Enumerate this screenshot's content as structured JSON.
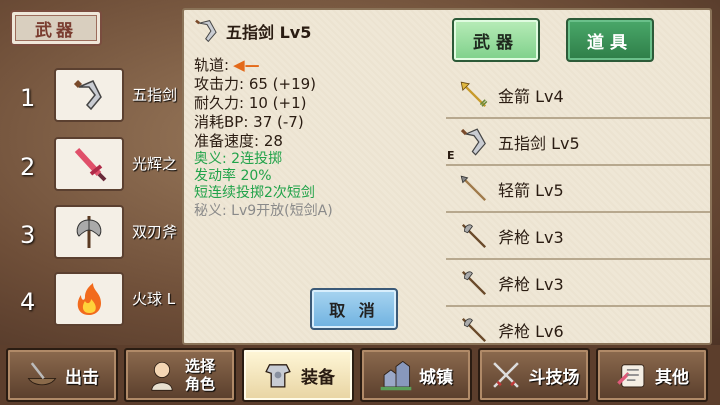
{
  "background_tag": "武器",
  "slots": [
    {
      "num": "1",
      "name": "五指剑",
      "icon": "five-finger-sword-icon"
    },
    {
      "num": "2",
      "name": "光辉之",
      "icon": "radiant-sword-icon"
    },
    {
      "num": "3",
      "name": "双刃斧",
      "icon": "double-axe-icon"
    },
    {
      "num": "4",
      "name": "火球 L",
      "icon": "fireball-icon"
    }
  ],
  "detail": {
    "title": "五指剑 Lv5",
    "track_label": "轨道:",
    "attack": "攻击力: 65 (+19)",
    "durability": "耐久力: 10 (+1)",
    "bp_cost": "消耗BP: 37 (-7)",
    "ready_speed": "准备速度: 28",
    "skill1": "奥义:  2连投掷",
    "skill2": "发动率 20%",
    "skill3": "短连续投掷2次短剑",
    "secret": "秘义: Lv9开放(短剑A)",
    "cancel_label": "取 消"
  },
  "tabs": {
    "weapon": "武器",
    "items": "道具"
  },
  "weapon_list": [
    {
      "name": "金箭 Lv4",
      "icon": "gold-arrow-icon",
      "equipped": ""
    },
    {
      "name": "五指剑 Lv5",
      "icon": "five-finger-sword-icon",
      "equipped": "E"
    },
    {
      "name": "轻箭 Lv5",
      "icon": "light-arrow-icon",
      "equipped": ""
    },
    {
      "name": "斧枪 Lv3",
      "icon": "halberd-icon",
      "equipped": ""
    },
    {
      "name": "斧枪 Lv3",
      "icon": "halberd-icon",
      "equipped": ""
    },
    {
      "name": "斧枪 Lv6",
      "icon": "halberd-icon",
      "equipped": ""
    }
  ],
  "nav": [
    {
      "label": "出击",
      "icon": "sortie-icon"
    },
    {
      "label": "选择角色",
      "line1": "选择",
      "line2": "角色",
      "icon": "character-icon"
    },
    {
      "label": "装备",
      "icon": "armor-icon",
      "active": true
    },
    {
      "label": "城镇",
      "icon": "town-icon"
    },
    {
      "label": "斗技场",
      "icon": "arena-swords-icon"
    },
    {
      "label": "其他",
      "icon": "other-icon"
    }
  ],
  "colors": {
    "green_text": "#22a34a",
    "orange_arrow": "#e46a1a",
    "cancel_blue": "#6fb2e0",
    "tab_green": "#2e7e48"
  }
}
